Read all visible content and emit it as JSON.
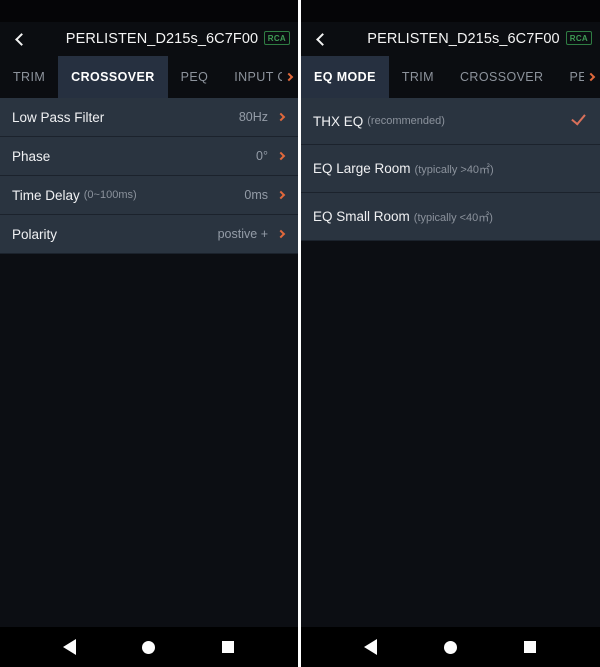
{
  "left_panel": {
    "titlebar": {
      "back_icon": "back-chevron-icon",
      "title": "PERLISTEN_D215s_6C7F00",
      "badge": "RCA"
    },
    "tabs": [
      {
        "label": "TRIM",
        "active": false
      },
      {
        "label": "CROSSOVER",
        "active": true
      },
      {
        "label": "PEQ",
        "active": false
      },
      {
        "label": "INPUT CONT",
        "active": false
      }
    ],
    "tab_scroll_icon": "chevron-right-icon",
    "rows": [
      {
        "label": "Low Pass Filter",
        "sub": "",
        "value": "80Hz",
        "accessory": "chevron-right-icon"
      },
      {
        "label": "Phase",
        "sub": "",
        "value": "0°",
        "accessory": "chevron-right-icon"
      },
      {
        "label": "Time Delay",
        "sub": "(0~100ms)",
        "value": "0ms",
        "accessory": "chevron-right-icon"
      },
      {
        "label": "Polarity",
        "sub": "",
        "value": "postive +",
        "accessory": "chevron-right-icon"
      }
    ]
  },
  "right_panel": {
    "titlebar": {
      "back_icon": "back-chevron-icon",
      "title": "PERLISTEN_D215s_6C7F00",
      "badge": "RCA"
    },
    "tabs": [
      {
        "label": "EQ MODE",
        "active": true
      },
      {
        "label": "TRIM",
        "active": false
      },
      {
        "label": "CROSSOVER",
        "active": false
      },
      {
        "label": "PEQ",
        "active": false
      }
    ],
    "tab_scroll_icon": "chevron-right-icon",
    "rows": [
      {
        "label": "THX EQ",
        "sub": "(recommended)",
        "value": "",
        "accessory": "check-icon"
      },
      {
        "label": "EQ Large Room",
        "sub": "(typically >40㎡)",
        "value": "",
        "accessory": ""
      },
      {
        "label": "EQ Small Room",
        "sub": "(typically <40㎡)",
        "value": "",
        "accessory": ""
      }
    ]
  },
  "navbar": {
    "back": "triangle-back-icon",
    "home": "circle-home-icon",
    "recents": "square-recents-icon"
  },
  "colors": {
    "accent_orange": "#e2693c",
    "check_salmon": "#d9705a",
    "badge_green": "#3f9b55",
    "row_bg": "#2a3440",
    "active_tab_bg": "#263040",
    "page_bg": "#0c0e13"
  }
}
